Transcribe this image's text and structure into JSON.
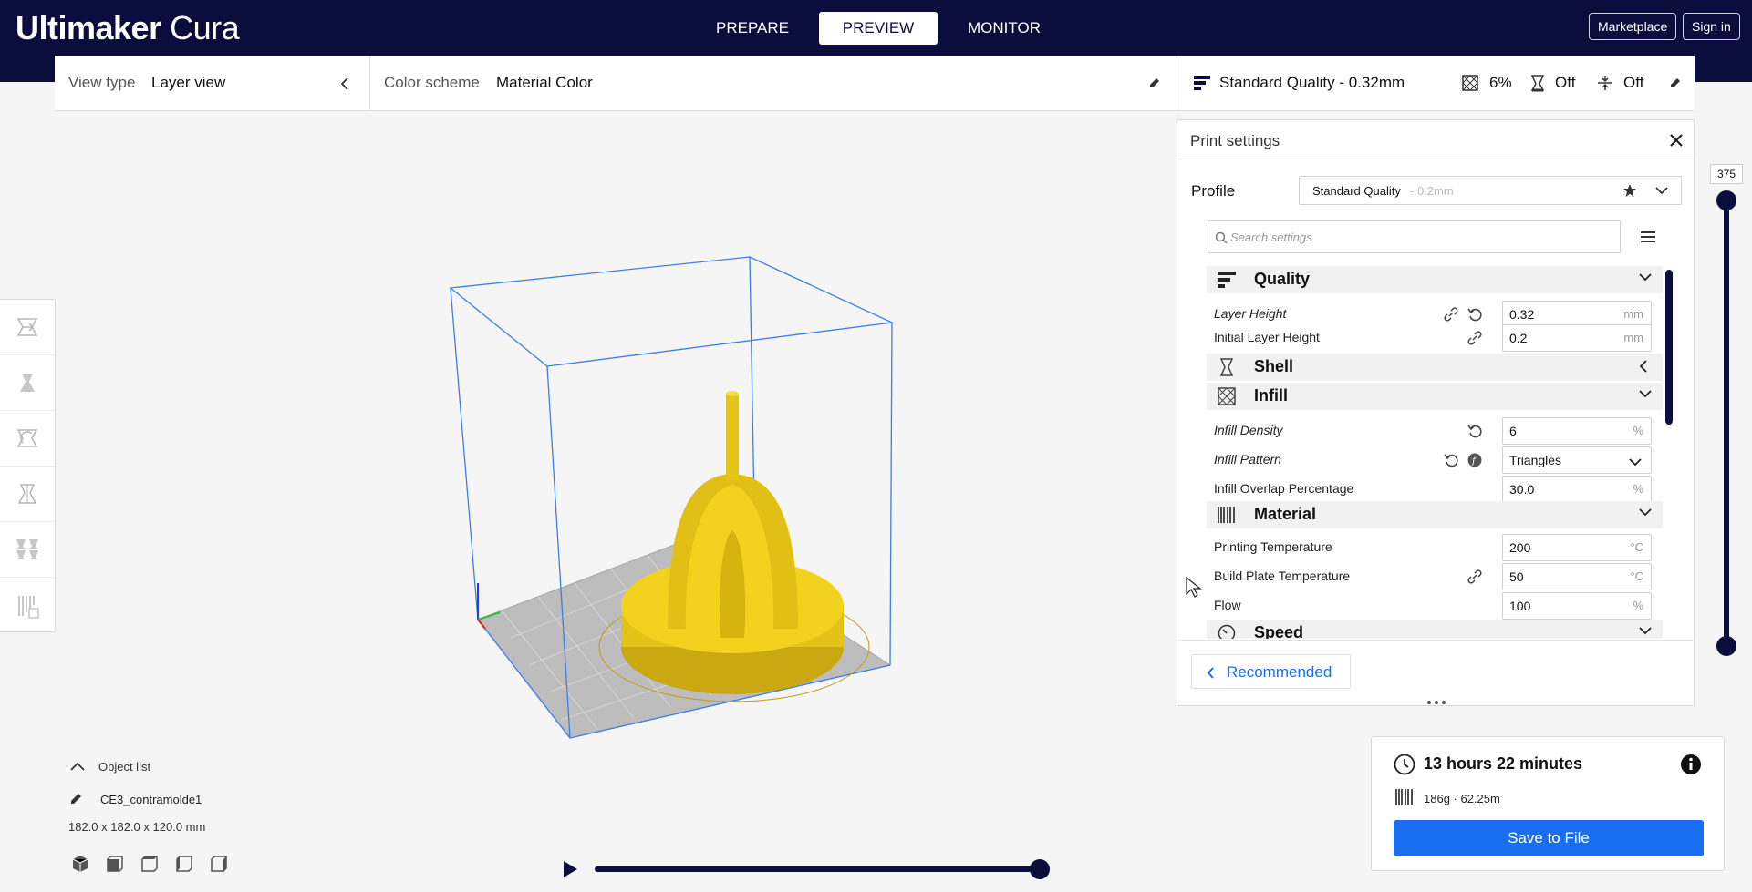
{
  "header": {
    "logo_bold": "Ultimaker",
    "logo_light": "Cura",
    "tabs": [
      {
        "label": "PREPARE"
      },
      {
        "label": "PREVIEW"
      },
      {
        "label": "MONITOR"
      }
    ],
    "marketplace": "Marketplace",
    "sign_in": "Sign in"
  },
  "view": {
    "view_type_label": "View type",
    "view_type_value": "Layer view",
    "color_scheme_label": "Color scheme",
    "color_scheme_value": "Material Color"
  },
  "print_summary": {
    "profile": "Standard Quality - 0.32mm",
    "infill": "6%",
    "support": "Off",
    "adhesion": "Off"
  },
  "print_settings": {
    "title": "Print settings",
    "profile_label": "Profile",
    "profile_value": "Standard Quality",
    "profile_suffix": " - 0.2mm",
    "search_placeholder": "Search settings",
    "categories": {
      "quality": "Quality",
      "shell": "Shell",
      "infill": "Infill",
      "material": "Material",
      "speed": "Speed"
    },
    "settings": {
      "layer_height": {
        "label": "Layer Height",
        "value": "0.32",
        "unit": "mm"
      },
      "initial_layer_height": {
        "label": "Initial Layer Height",
        "value": "0.2",
        "unit": "mm"
      },
      "infill_density": {
        "label": "Infill Density",
        "value": "6",
        "unit": "%"
      },
      "infill_pattern": {
        "label": "Infill Pattern",
        "value": "Triangles"
      },
      "infill_overlap": {
        "label": "Infill Overlap Percentage",
        "value": "30.0",
        "unit": "%"
      },
      "printing_temperature": {
        "label": "Printing Temperature",
        "value": "200",
        "unit": "°C"
      },
      "build_plate_temperature": {
        "label": "Build Plate Temperature",
        "value": "50",
        "unit": "°C"
      },
      "flow": {
        "label": "Flow",
        "value": "100",
        "unit": "%"
      }
    },
    "recommended_button": "Recommended"
  },
  "layer_slider": {
    "current_layer": "375"
  },
  "object_list": {
    "header": "Object list",
    "object_name": "CE3_contramolde1",
    "dimensions": "182.0 x 182.0 x 120.0 mm"
  },
  "estimate": {
    "time": "13 hours 22 minutes",
    "material": "186g · 62.25m",
    "save_button": "Save to File"
  },
  "colors": {
    "header_bg": "#0b0d3d",
    "accent_blue": "#196ef0",
    "model_yellow": "#f2d21f",
    "build_volume_lines": "#3c7fe6"
  }
}
